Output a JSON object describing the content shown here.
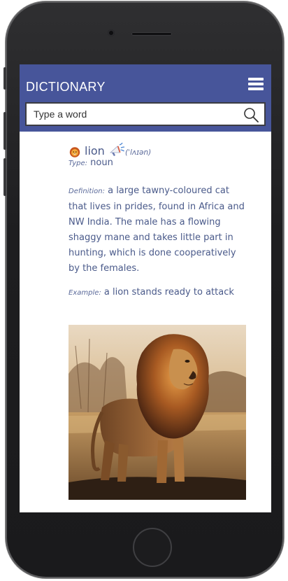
{
  "header": {
    "title": "DICTIONARY"
  },
  "search": {
    "placeholder": "Type a word"
  },
  "entry": {
    "emoji": "lion-face-emoji",
    "word": "lion",
    "pronunciation": "(ˈlʌɪən)",
    "type_label": "Type:",
    "type_value": "noun",
    "definition_label": "Definition:",
    "definition_value": "a large tawny-coloured cat that lives in prides, found in Africa and NW India. The male has a flowing shaggy mane and takes little part in hunting, which is done cooperatively by the females.",
    "example_label": "Example:",
    "example_value": "a lion stands ready to attack"
  },
  "icons": {
    "menu": "hamburger-menu-icon",
    "search": "magnifier-search-icon",
    "speaker": "megaphone-speaker-icon"
  },
  "colors": {
    "header_bg": "#47559a",
    "text": "#4a5a8a"
  }
}
